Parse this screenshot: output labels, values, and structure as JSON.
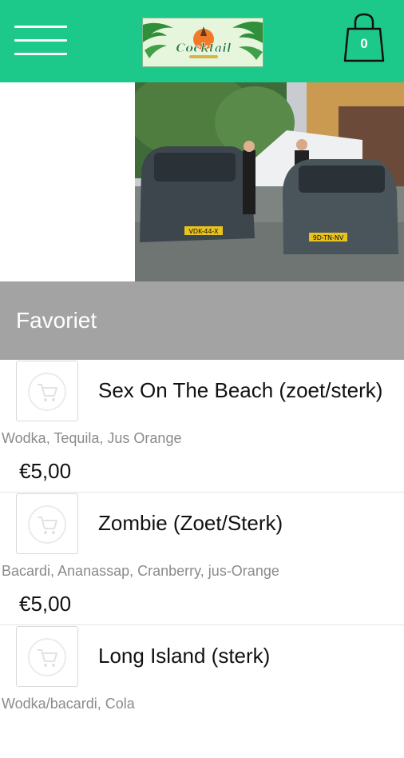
{
  "header": {
    "logo_text": "Cocktail",
    "cart_count": "0"
  },
  "section": {
    "title": "Favoriet"
  },
  "products": [
    {
      "name": "Sex On The Beach (zoet/sterk)",
      "description": "Wodka, Tequila, Jus Orange",
      "price": "€5,00"
    },
    {
      "name": "Zombie (Zoet/Sterk)",
      "description": "Bacardi, Ananassap, Cranberry, jus-Orange",
      "price": "€5,00"
    },
    {
      "name": "Long Island (sterk)",
      "description": "Wodka/bacardi, Cola",
      "price": ""
    }
  ],
  "hero": {
    "plate_left": "VDK-44-X",
    "plate_right": "9D-TN-NV"
  },
  "colors": {
    "header": "#1dc98a",
    "section_bar": "#a3a3a3"
  }
}
